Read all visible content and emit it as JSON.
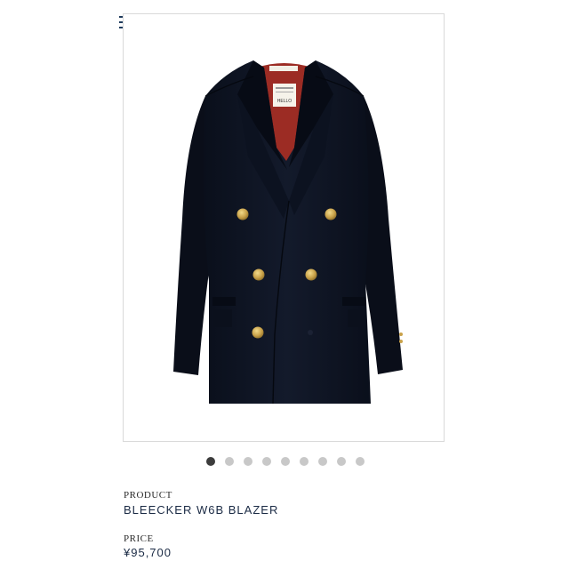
{
  "header": {
    "menu_icon": "hamburger-menu-icon"
  },
  "product_image": {
    "subject": "navy double-breasted blazer with gold buttons",
    "tag_lines": [
      "HELLO"
    ]
  },
  "carousel": {
    "total": 9,
    "active_index": 0
  },
  "product": {
    "product_label": "PRODUCT",
    "name": "BLEECKER W6B BLAZER",
    "price_label": "PRICE",
    "price": "¥95,700"
  },
  "colors": {
    "accent": "#1e3a5c",
    "jacket": "#0d1220",
    "lining": "#9c2c24",
    "button": "#c9a24a"
  }
}
